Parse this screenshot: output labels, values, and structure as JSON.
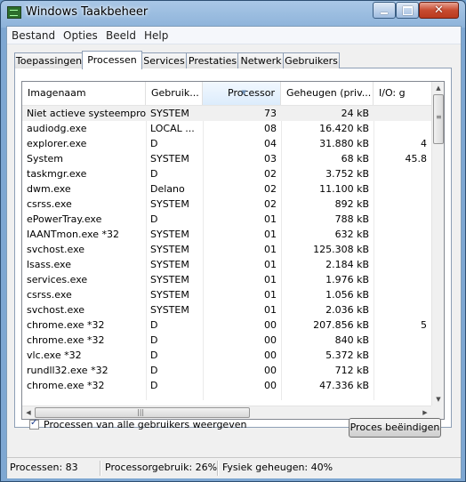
{
  "window": {
    "title": "Windows Taakbeheer"
  },
  "menu": [
    "Bestand",
    "Opties",
    "Beeld",
    "Help"
  ],
  "tabs": [
    "Toepassingen",
    "Processen",
    "Services",
    "Prestaties",
    "Netwerk",
    "Gebruikers"
  ],
  "active_tab": "Processen",
  "table": {
    "columns": [
      "Imagenaam",
      "Gebruik...",
      "Processor",
      "Geheugen (priv...",
      "I/O: g"
    ],
    "sorted_column": "Processor",
    "rows": [
      [
        "Niet actieve systeempro...",
        "SYSTEM",
        "73",
        "24 kB",
        ""
      ],
      [
        "audiodg.exe",
        "LOCAL ...",
        "08",
        "16.420 kB",
        ""
      ],
      [
        "explorer.exe",
        "D",
        "04",
        "31.880 kB",
        "4"
      ],
      [
        "System",
        "SYSTEM",
        "03",
        "68 kB",
        "45.8"
      ],
      [
        "taskmgr.exe",
        "D",
        "02",
        "3.752 kB",
        ""
      ],
      [
        "dwm.exe",
        "Delano",
        "02",
        "11.100 kB",
        ""
      ],
      [
        "csrss.exe",
        "SYSTEM",
        "02",
        "892 kB",
        ""
      ],
      [
        "ePowerTray.exe",
        "D",
        "01",
        "788 kB",
        ""
      ],
      [
        "IAANTmon.exe *32",
        "SYSTEM",
        "01",
        "632 kB",
        ""
      ],
      [
        "svchost.exe",
        "SYSTEM",
        "01",
        "125.308 kB",
        ""
      ],
      [
        "lsass.exe",
        "SYSTEM",
        "01",
        "2.184 kB",
        ""
      ],
      [
        "services.exe",
        "SYSTEM",
        "01",
        "1.976 kB",
        ""
      ],
      [
        "csrss.exe",
        "SYSTEM",
        "01",
        "1.056 kB",
        ""
      ],
      [
        "svchost.exe",
        "SYSTEM",
        "01",
        "2.036 kB",
        ""
      ],
      [
        "chrome.exe *32",
        "D",
        "00",
        "207.856 kB",
        "5"
      ],
      [
        "chrome.exe *32",
        "D",
        "00",
        "840 kB",
        ""
      ],
      [
        "vlc.exe *32",
        "D",
        "00",
        "5.372 kB",
        ""
      ],
      [
        "rundll32.exe *32",
        "D",
        "00",
        "712 kB",
        ""
      ],
      [
        "chrome.exe *32",
        "D",
        "00",
        "47.336 kB",
        ""
      ]
    ]
  },
  "show_all_users": {
    "label": "Processen van alle gebruikers weergeven",
    "checked": true
  },
  "end_process_button": "Proces beëindigen",
  "status": {
    "processes": "Processen: 83",
    "cpu": "Processorgebruik: 26%",
    "memory": "Fysiek geheugen: 40%"
  },
  "icons": {
    "app": "task-manager-icon",
    "minimize": "minimize-icon",
    "maximize": "maximize-icon",
    "close": "close-icon"
  }
}
